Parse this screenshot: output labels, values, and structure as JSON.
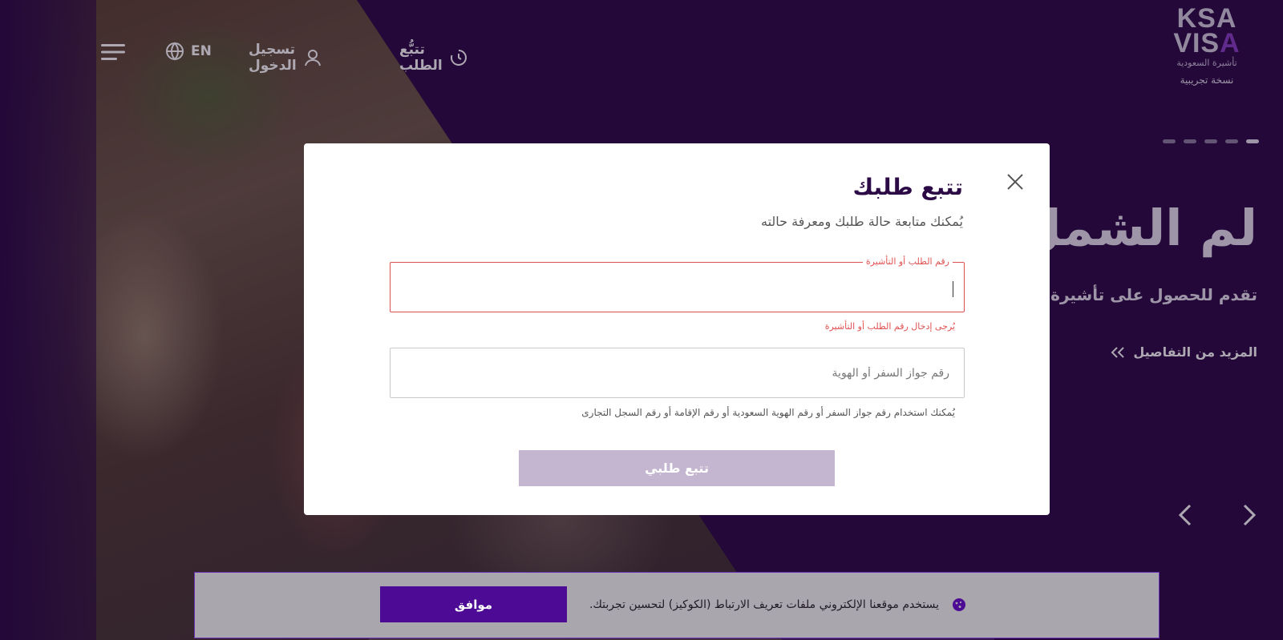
{
  "header": {
    "logo_text_ltr": "KSA VISA",
    "logo_subtitle": "تأشيرة السعودية",
    "logo_tag": "نسخة تجريبية",
    "nav_track": "تتبُّع الطلب",
    "nav_login": "تسجيل الدخول",
    "nav_lang": "EN"
  },
  "hero": {
    "title": "لم الشمل",
    "subtitle": "تقدم للحصول على تأشيرة زيارة",
    "more_link": "المزيد من التفاصيل",
    "slides_count": 5,
    "active_slide": 1
  },
  "modal": {
    "title": "تتبع طلبك",
    "description": "يُمكنك متابعة حالة طلبك ومعرفة حالته",
    "field1_label": "رقم الطلب أو التأشيرة",
    "field1_value": "",
    "field1_error": "يُرجى إدخال رقم الطلب أو التأشيرة",
    "field2_placeholder": "رقم جواز السفر أو الهوية",
    "field2_value": "",
    "field2_hint": "يُمكنك استخدام رقم جواز السفر أو رقم الهوية السعودية أو رقم الإقامة أو رقم السجل التجارى",
    "submit_label": "تتبع طلبي"
  },
  "cookie": {
    "text": "يستخدم موقعنا الإلكتروني ملفات تعريف الارتباط (الكوكيز) لتحسين تجربتك.",
    "accept_label": "موافق"
  },
  "colors": {
    "brand_dark": "#2b0a45",
    "brand_purple": "#4d0a94",
    "error": "#e05050",
    "button_disabled": "#c4b5d0"
  }
}
